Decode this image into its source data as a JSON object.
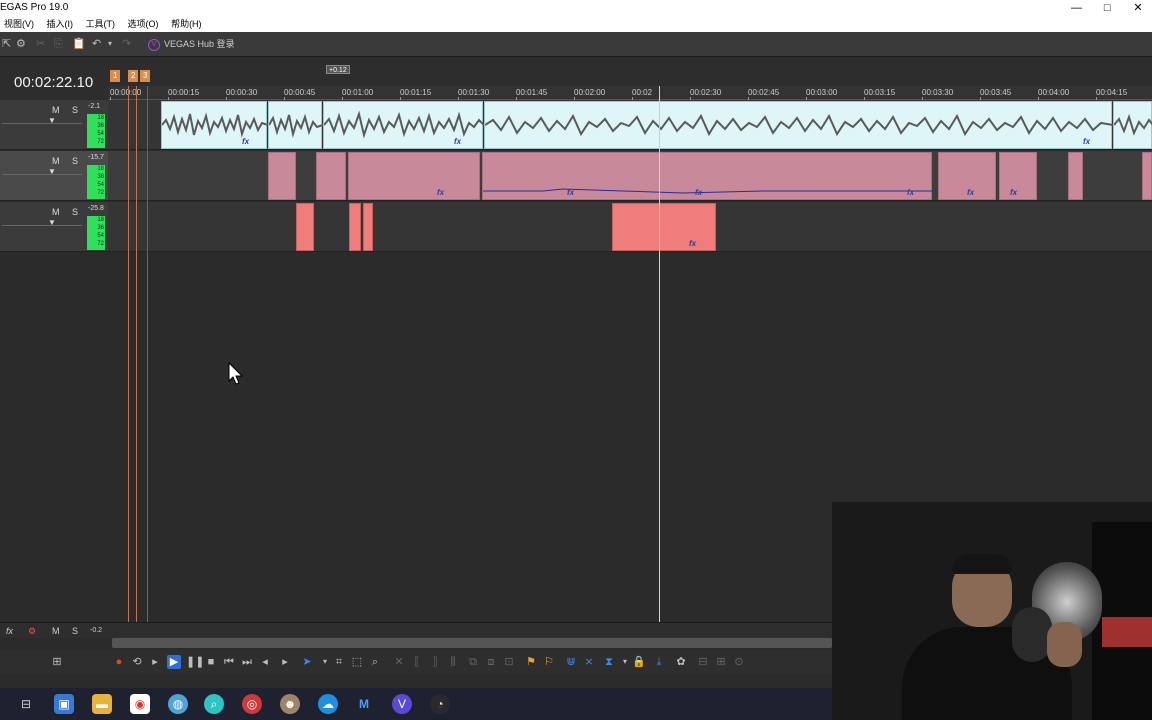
{
  "window": {
    "title": "EGAS Pro 19.0",
    "min": "—",
    "max": "□",
    "close": "✕"
  },
  "menu": [
    "视图(V)",
    "插入(I)",
    "工具(T)",
    "选项(O)",
    "帮助(H)"
  ],
  "toolbar": {
    "hub_label": "VEGAS Hub 登录"
  },
  "timecode": "00:02:22.10",
  "markers": [
    "1",
    "2",
    "3"
  ],
  "offset_label": "+0.12",
  "ruler_labels": [
    "00:00:00",
    "00:00:15",
    "00:00:30",
    "00:00:45",
    "00:01:00",
    "00:01:15",
    "00:01:30",
    "00:01:45",
    "00:02:00",
    "00:02",
    "00:02:30",
    "00:02:45",
    "00:03:00",
    "00:03:15",
    "00:03:30",
    "00:03:45",
    "00:04:00",
    "00:04:15"
  ],
  "tracks": [
    {
      "m": "M",
      "s": "S",
      "db": "-2.1",
      "meter": [
        "18",
        "36",
        "54",
        "72"
      ]
    },
    {
      "m": "M",
      "s": "S",
      "db": "-15.7",
      "meter": [
        "18",
        "36",
        "54",
        "72"
      ]
    },
    {
      "m": "M",
      "s": "S",
      "db": "-25.8",
      "meter": [
        "18",
        "36",
        "54",
        "72"
      ]
    }
  ],
  "clip_fx_label": "fx",
  "master": {
    "fx": "fx",
    "m": "M",
    "s": "S",
    "db": "-0.2"
  },
  "colors": {
    "accent_play": "#2f6fd6",
    "meter_green": "#2ee05a",
    "clip_pink": "#c88a9a",
    "clip_red": "#f07c7c",
    "clip_audio": "#dff6f8"
  }
}
